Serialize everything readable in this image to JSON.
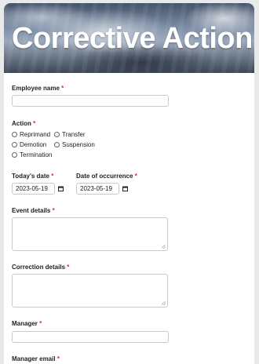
{
  "header": {
    "title": "Corrective Action"
  },
  "required_mark": "*",
  "fields": {
    "employee_name": {
      "label": "Employee name"
    },
    "action": {
      "label": "Action",
      "options": [
        "Reprimand",
        "Transfer",
        "Demotion",
        "Suspension",
        "Termination"
      ]
    },
    "todays_date": {
      "label": "Today's date",
      "value": "2023-05-19"
    },
    "occurrence_date": {
      "label": "Date of occurrence",
      "value": "2023-05-19"
    },
    "event_details": {
      "label": "Event details"
    },
    "correction_details": {
      "label": "Correction details"
    },
    "manager": {
      "label": "Manager"
    },
    "manager_email": {
      "label": "Manager email"
    }
  },
  "icons": {
    "calendar": "calendar-icon",
    "required": "asterisk"
  },
  "colors": {
    "required": "#d93025",
    "border": "#c6c9cd",
    "background": "#e8e9eb"
  }
}
